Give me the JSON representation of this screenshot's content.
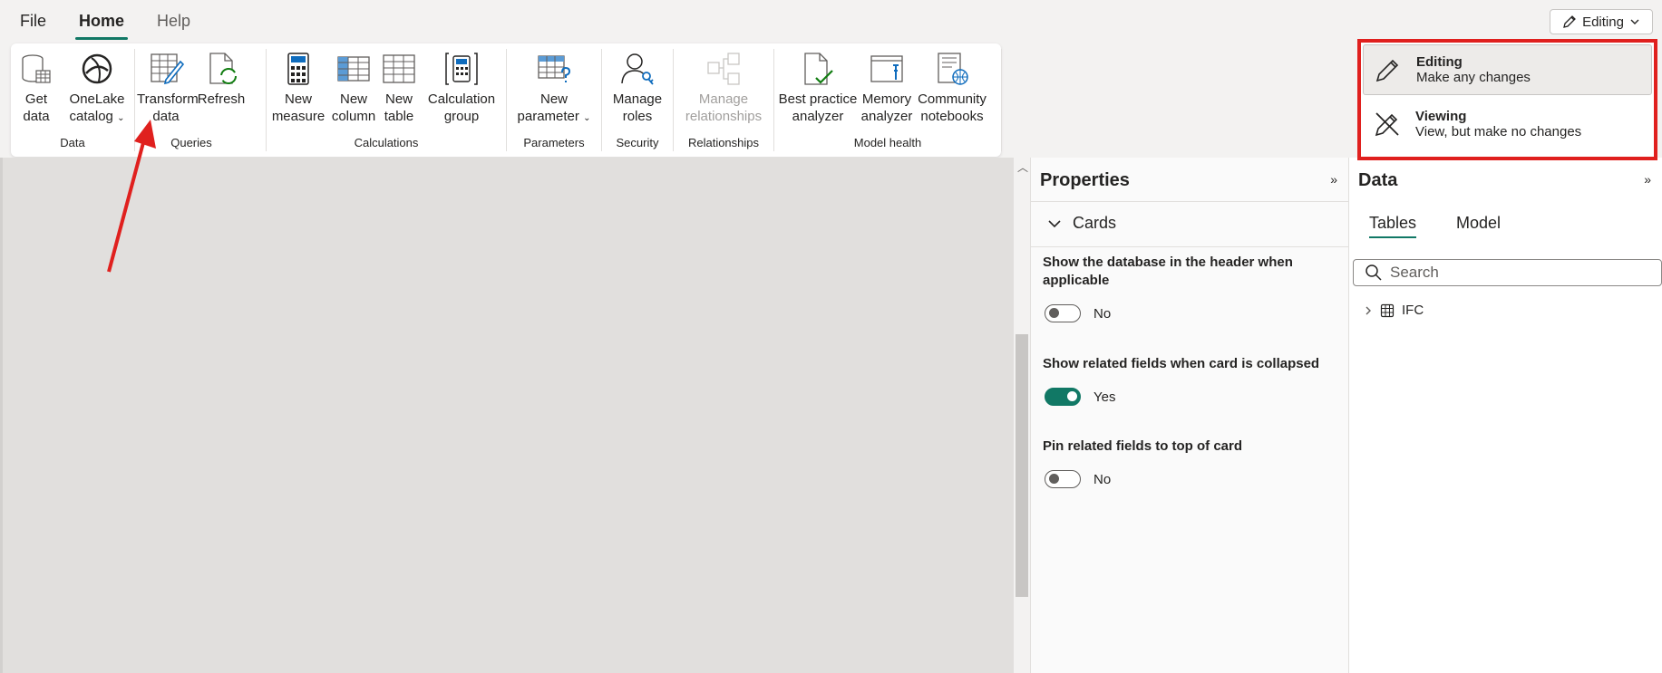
{
  "menu": {
    "file": "File",
    "home": "Home",
    "help": "Help"
  },
  "mode_button": {
    "label": "Editing"
  },
  "ribbon": {
    "data_group": {
      "label": "Data",
      "get_data": [
        "Get",
        "data"
      ],
      "onelake": [
        "OneLake",
        "catalog"
      ]
    },
    "queries_group": {
      "label": "Queries",
      "transform": [
        "Transform",
        "data"
      ],
      "refresh": [
        "Refresh"
      ]
    },
    "calc_group": {
      "label": "Calculations",
      "new_measure": [
        "New",
        "measure"
      ],
      "new_column": [
        "New",
        "column"
      ],
      "new_table": [
        "New",
        "table"
      ],
      "calc_group": [
        "Calculation",
        "group"
      ]
    },
    "params_group": {
      "label": "Parameters",
      "new_parameter": [
        "New",
        "parameter"
      ]
    },
    "security_group": {
      "label": "Security",
      "manage_roles": [
        "Manage",
        "roles"
      ]
    },
    "rel_group": {
      "label": "Relationships",
      "manage_rel": [
        "Manage",
        "relationships"
      ]
    },
    "health_group": {
      "label": "Model health",
      "bpa": [
        "Best practice",
        "analyzer"
      ],
      "memory": [
        "Memory",
        "analyzer"
      ],
      "community": [
        "Community",
        "notebooks"
      ]
    }
  },
  "properties": {
    "title": "Properties",
    "section": "Cards",
    "settings": [
      {
        "label": "Show the database in the header when applicable",
        "value": "No",
        "on": false
      },
      {
        "label": "Show related fields when card is collapsed",
        "value": "Yes",
        "on": true
      },
      {
        "label": "Pin related fields to top of card",
        "value": "No",
        "on": false
      }
    ]
  },
  "data_pane": {
    "title": "Data",
    "tabs": [
      "Tables",
      "Model"
    ],
    "search_placeholder": "Search",
    "tree_item": "IFC"
  },
  "mode_dropdown": {
    "options": [
      {
        "title": "Editing",
        "desc": "Make any changes"
      },
      {
        "title": "Viewing",
        "desc": "View, but make no changes"
      }
    ]
  },
  "colors": {
    "accent": "#117865",
    "highlight_border": "#e0201e",
    "arrow": "#e0201e"
  }
}
